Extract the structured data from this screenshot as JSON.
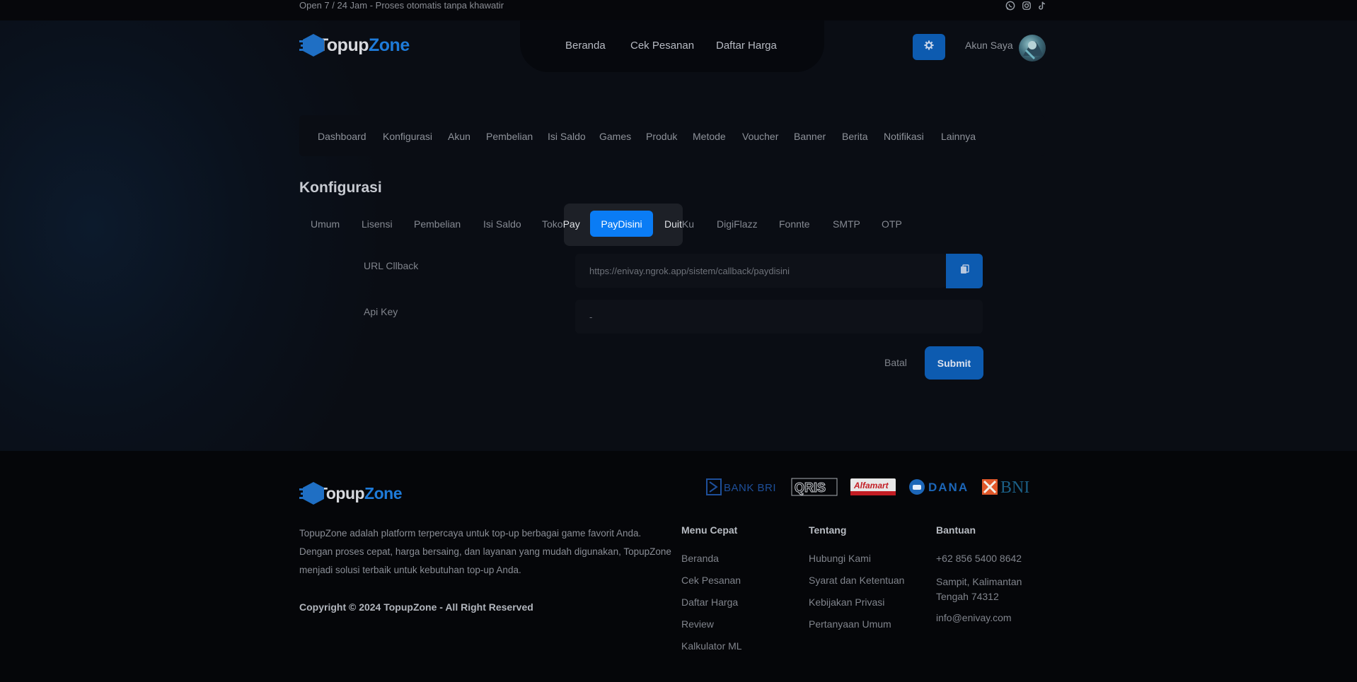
{
  "topbar": {
    "tagline": "Open 7 / 24 Jam - Proses otomatis tanpa khawatir",
    "social": [
      "whatsapp-icon",
      "instagram-icon",
      "tiktok-icon"
    ]
  },
  "brand": {
    "name_part1": "Topup",
    "name_part2": "Zone",
    "accent": "#1e7bd9"
  },
  "nav": {
    "items": [
      "Beranda",
      "Cek Pesanan",
      "Daftar Harga"
    ]
  },
  "account": {
    "label": "Akun Saya"
  },
  "admin_menu": {
    "items": [
      "Dashboard",
      "Konfigurasi",
      "Akun",
      "Pembelian",
      "Isi Saldo",
      "Games",
      "Produk",
      "Metode",
      "Voucher",
      "Banner",
      "Berita",
      "Notifikasi",
      "Lainnya"
    ]
  },
  "page": {
    "title": "Konfigurasi"
  },
  "tabs": {
    "items": [
      "Umum",
      "Lisensi",
      "Pembelian",
      "Isi Saldo",
      "TokoPay",
      "PayDisini",
      "DuitKu",
      "DigiFlazz",
      "Fonnte",
      "SMTP",
      "OTP"
    ],
    "active": "PayDisini",
    "active_color": "#0a7cf5"
  },
  "form": {
    "callback_label": "URL Cllback",
    "callback_value": "https://enivay.ngrok.app/sistem/callback/paydisini",
    "apikey_label": "Api Key",
    "apikey_value": "-",
    "cancel_label": "Batal",
    "submit_label": "Submit"
  },
  "footer": {
    "description": "TopupZone adalah platform terpercaya untuk top-up berbagai game favorit Anda. Dengan proses cepat, harga bersaing, dan layanan yang mudah digunakan, TopupZone menjadi solusi terbaik untuk kebutuhan top-up Anda.",
    "copyright": "Copyright © 2024 TopupZone - All Right Reserved",
    "payments": [
      "BANK BRI",
      "QRIS",
      "Alfamart",
      "DANA",
      "BNI"
    ],
    "menu_cepat": {
      "title": "Menu Cepat",
      "links": [
        "Beranda",
        "Cek Pesanan",
        "Daftar Harga",
        "Review",
        "Kalkulator ML"
      ]
    },
    "tentang": {
      "title": "Tentang",
      "links": [
        "Hubungi Kami",
        "Syarat dan Ketentuan",
        "Kebijakan Privasi",
        "Pertanyaan Umum"
      ]
    },
    "bantuan": {
      "title": "Bantuan",
      "phone": "+62 856 5400 8642",
      "address": "Sampit, Kalimantan Tengah 74312",
      "email": "info@enivay.com"
    }
  }
}
